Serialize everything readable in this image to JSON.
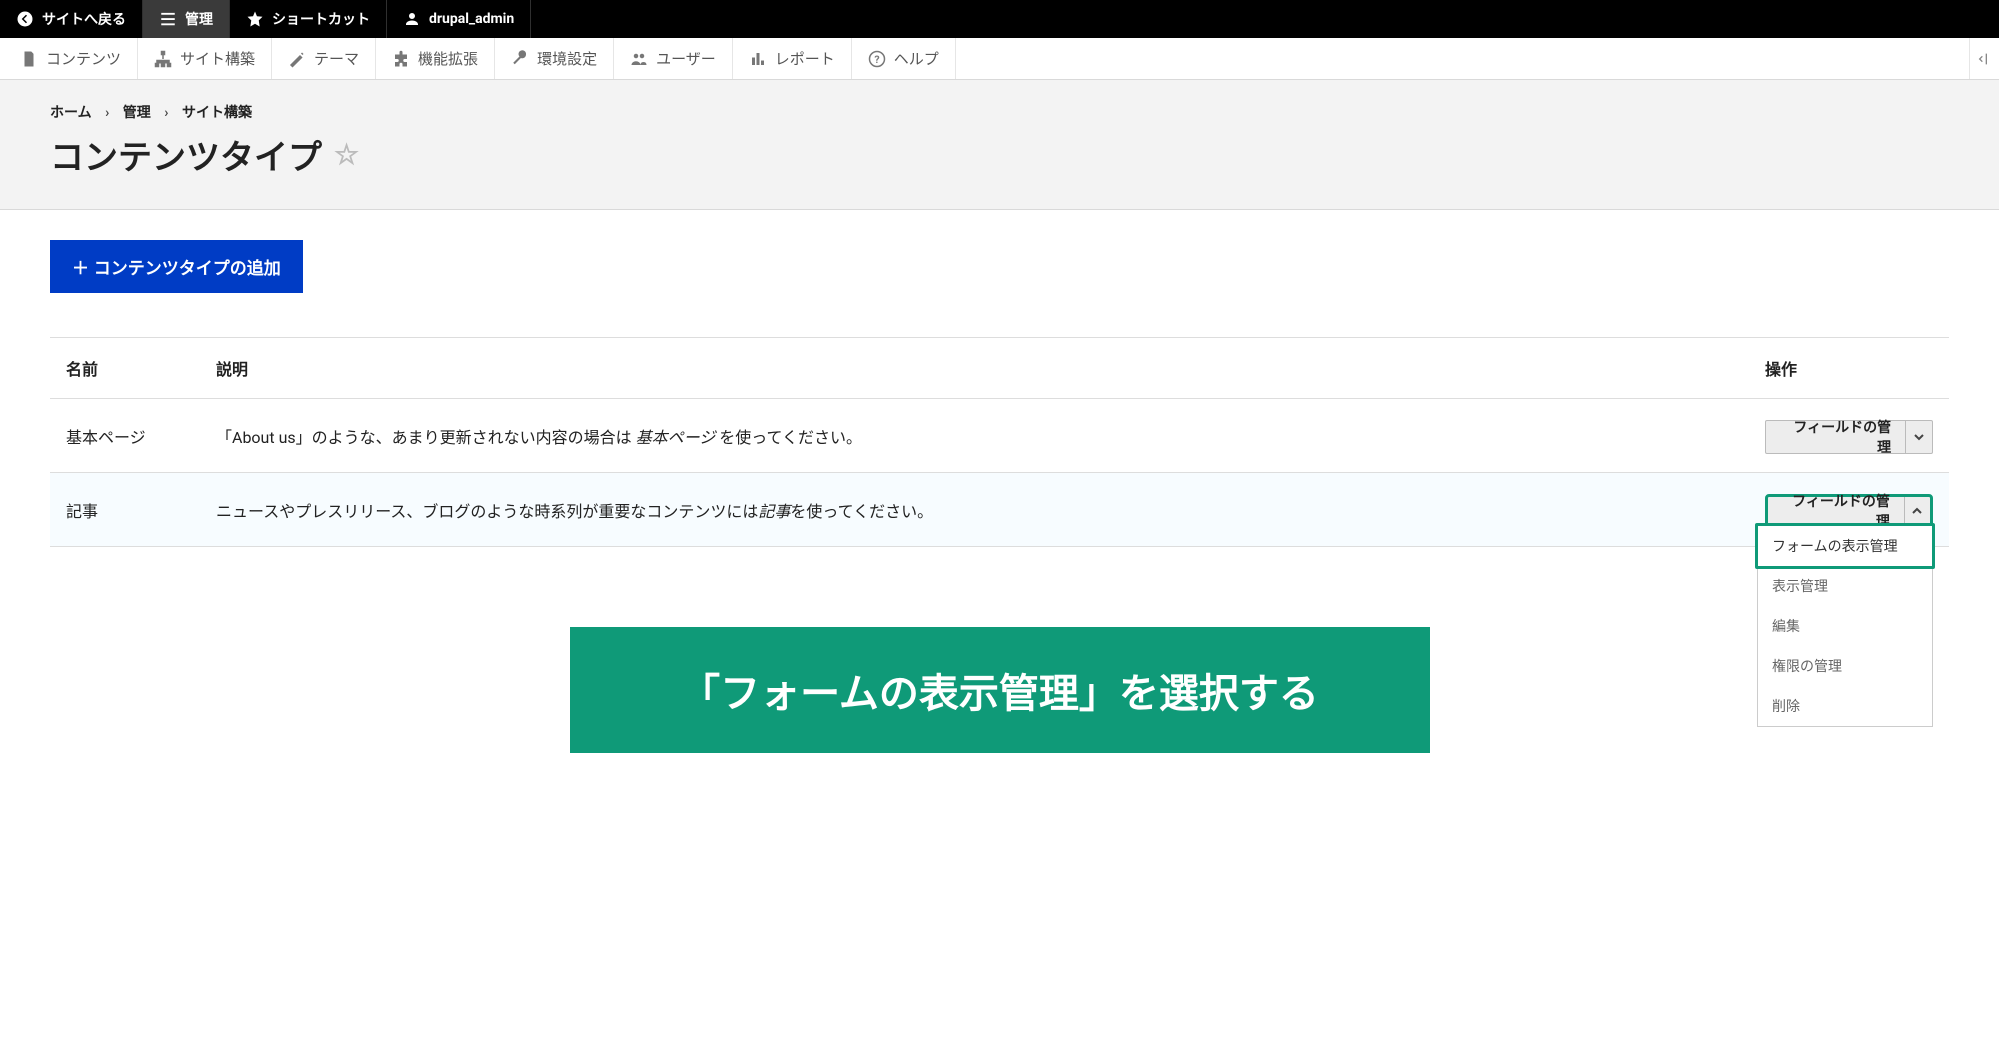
{
  "topbar": {
    "back_to_site": "サイトへ戻る",
    "manage": "管理",
    "shortcuts": "ショートカット",
    "user": "drupal_admin"
  },
  "adminmenu": {
    "content": "コンテンツ",
    "structure": "サイト構築",
    "appearance": "テーマ",
    "extend": "機能拡張",
    "config": "環境設定",
    "people": "ユーザー",
    "reports": "レポート",
    "help": "ヘルプ"
  },
  "breadcrumb": {
    "home": "ホーム",
    "manage": "管理",
    "structure": "サイト構築"
  },
  "page_title": "コンテンツタイプ",
  "action_button": "＋ コンテンツタイプの追加",
  "table": {
    "headers": {
      "name": "名前",
      "desc": "説明",
      "op": "操作"
    },
    "rows": [
      {
        "name": "基本ページ",
        "desc_pre": "「About us」のような、あまり更新されない内容の場合は ",
        "desc_em": "基本ページ ",
        "desc_post": "を使ってください。",
        "op_label": "フィールドの管理",
        "open": false
      },
      {
        "name": "記事",
        "desc_pre": "ニュースやプレスリリース、ブログのような時系列が重要なコンテンツには",
        "desc_em": "記事",
        "desc_post": "を使ってください。",
        "op_label": "フィールドの管理",
        "open": true
      }
    ]
  },
  "dropdown": {
    "form_display": "フォームの表示管理",
    "display": "表示管理",
    "edit": "編集",
    "permissions": "権限の管理",
    "delete": "削除"
  },
  "callout": "「フォームの表示管理」を選択する"
}
